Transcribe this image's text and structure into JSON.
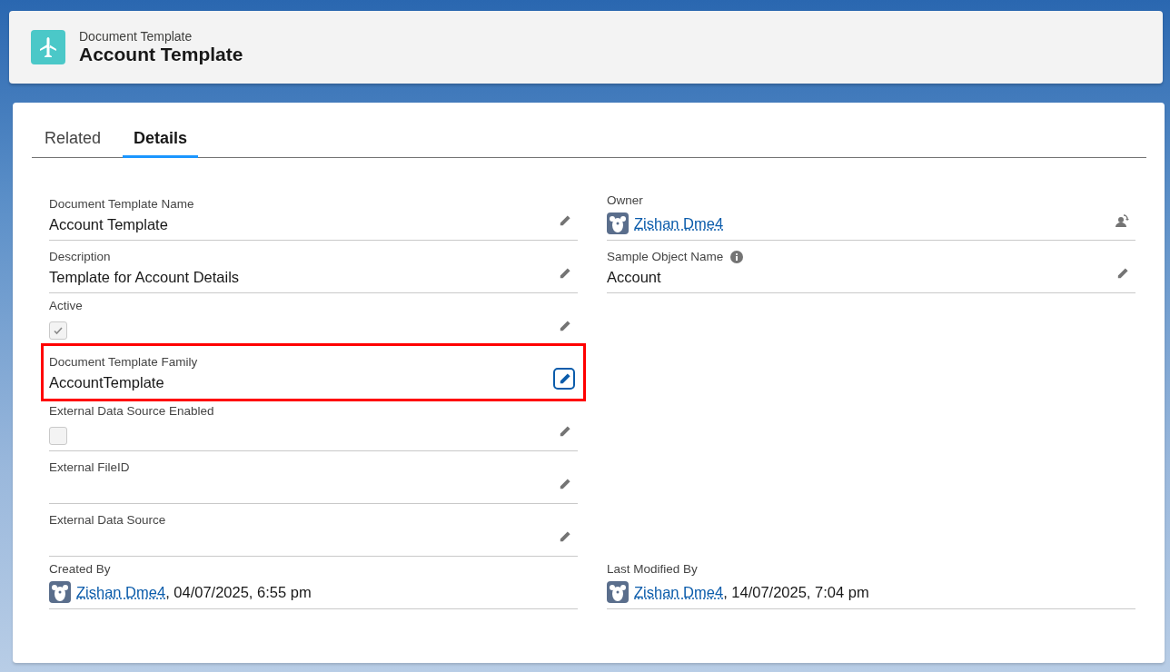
{
  "header": {
    "object_type": "Document Template",
    "title": "Account Template"
  },
  "tabs": [
    {
      "label": "Related",
      "selected": false
    },
    {
      "label": "Details",
      "selected": true
    }
  ],
  "left_fields": [
    {
      "label": "Document Template Name",
      "kind": "text",
      "value": "Account Template",
      "action": {
        "kind": "edit",
        "focused": false
      },
      "highlighted": false
    },
    {
      "label": "Description",
      "kind": "text",
      "value": "Template for Account Details",
      "action": {
        "kind": "edit",
        "focused": false
      },
      "highlighted": false
    },
    {
      "label": "Active",
      "kind": "checkbox",
      "checked": true,
      "action": {
        "kind": "edit",
        "focused": false
      },
      "highlighted": false
    },
    {
      "label": "Document Template Family",
      "kind": "text",
      "value": "AccountTemplate",
      "action": {
        "kind": "edit",
        "focused": true
      },
      "highlighted": true
    },
    {
      "label": "External Data Source Enabled",
      "kind": "checkbox",
      "checked": false,
      "action": {
        "kind": "edit",
        "focused": false
      },
      "highlighted": false
    },
    {
      "label": "External FileID",
      "kind": "empty",
      "action": {
        "kind": "edit",
        "focused": false
      },
      "highlighted": false
    },
    {
      "label": "External Data Source",
      "kind": "empty",
      "action": {
        "kind": "edit",
        "focused": false
      },
      "highlighted": false
    }
  ],
  "right_fields": [
    {
      "label": "Owner",
      "kind": "user",
      "user": "Zishan Dme4",
      "action": {
        "kind": "change_owner"
      }
    },
    {
      "label": "Sample Object Name",
      "kind": "text",
      "value": "Account",
      "info": true,
      "action": {
        "kind": "edit",
        "focused": false
      }
    }
  ],
  "footer_fields": [
    {
      "label": "Created By",
      "kind": "user",
      "user": "Zishan Dme4",
      "suffix": ", 04/07/2025, 6:55 pm"
    },
    {
      "label": "Last Modified By",
      "kind": "user",
      "user": "Zishan Dme4",
      "suffix": ", 14/07/2025, 7:04 pm"
    }
  ]
}
